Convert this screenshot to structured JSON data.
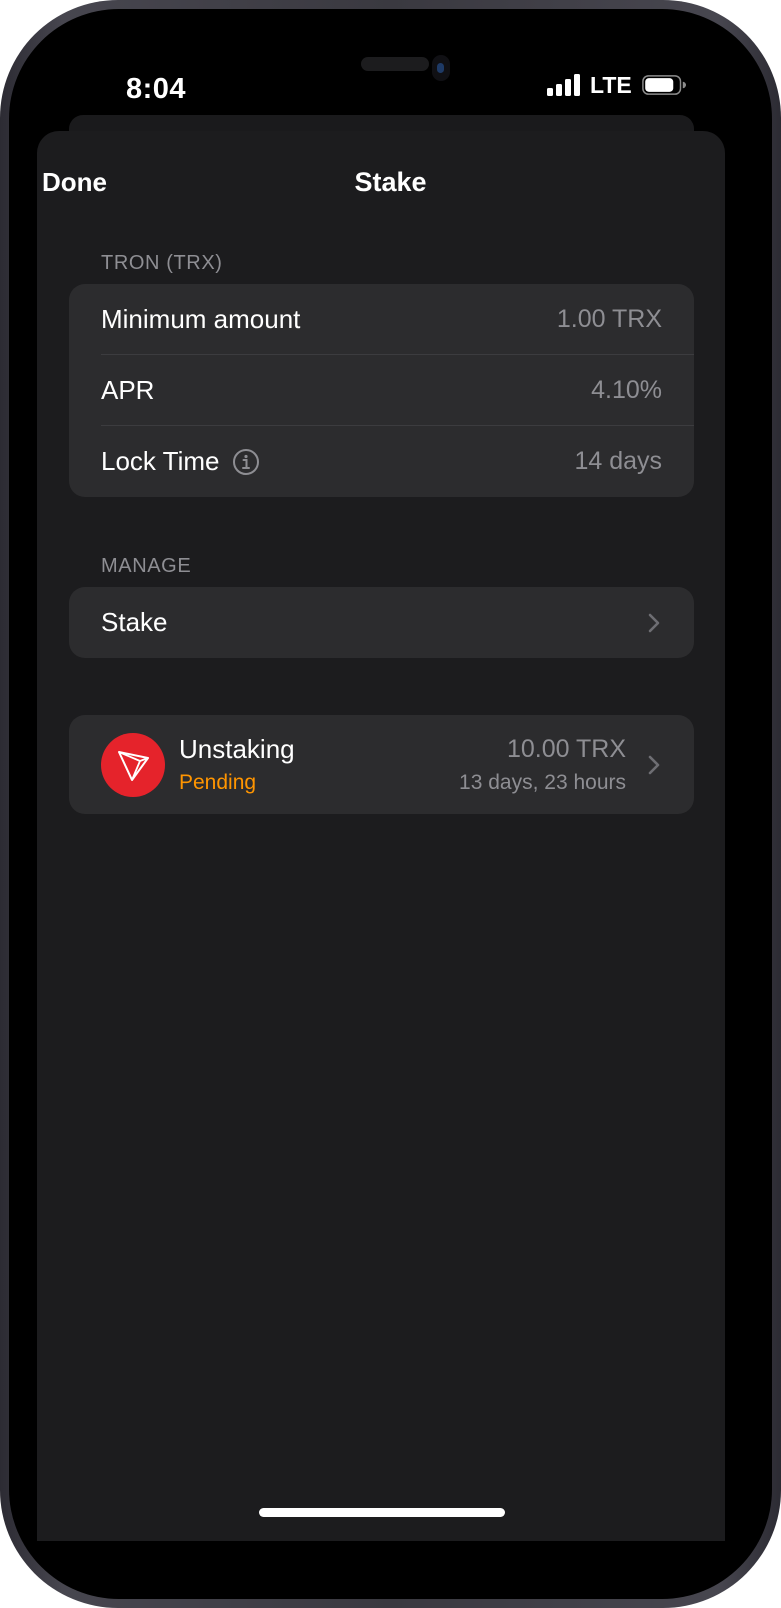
{
  "status_bar": {
    "time": "8:04",
    "network": "LTE",
    "signal_bars": 4,
    "battery_level": 0.85
  },
  "nav": {
    "done_label": "Done",
    "title": "Stake"
  },
  "info_section": {
    "header": "TRON (TRX)",
    "rows": [
      {
        "label": "Minimum amount",
        "value": "1.00 TRX"
      },
      {
        "label": "APR",
        "value": "4.10%"
      },
      {
        "label": "Lock Time",
        "value": "14 days",
        "icon": "info-icon"
      }
    ]
  },
  "manage_section": {
    "header": "MANAGE",
    "stake_label": "Stake"
  },
  "unstaking": {
    "title": "Unstaking",
    "status": "Pending",
    "amount": "10.00 TRX",
    "remaining": "13 days, 23 hours",
    "icon": "tron-logo-icon"
  },
  "colors": {
    "background": "#000000",
    "sheet": "#1c1c1e",
    "card": "#2c2c2e",
    "secondary_text": "#8e8e93",
    "pending": "#ff9500",
    "tron_red": "#e5232b"
  }
}
